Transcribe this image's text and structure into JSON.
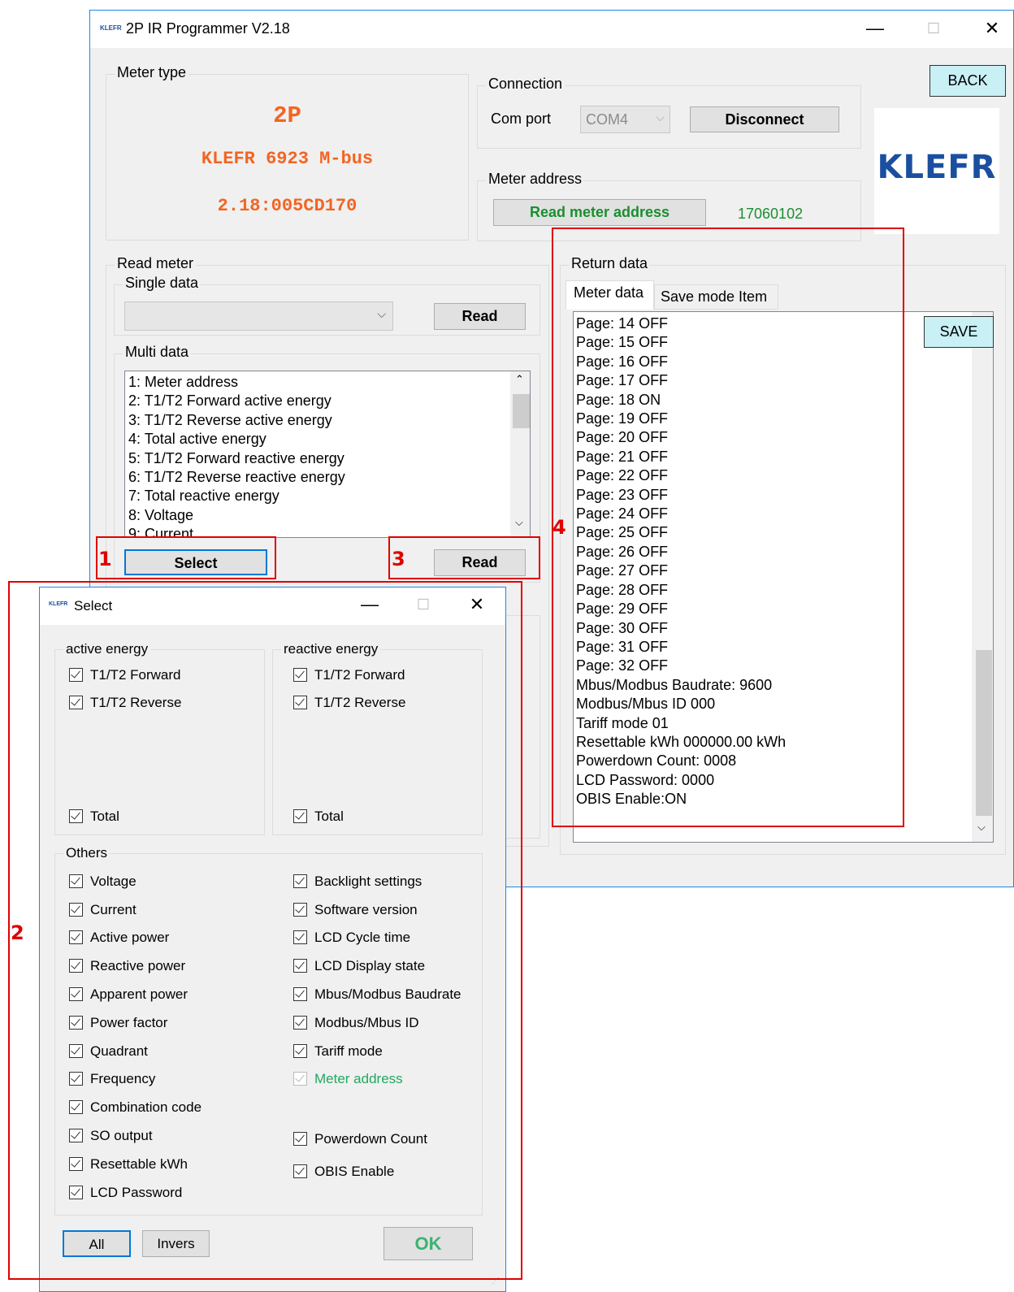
{
  "main_window": {
    "title": "2P IR Programmer V2.18",
    "logo_small": "KLEFR",
    "minimize": "—",
    "maximize": "☐",
    "close": "✕",
    "back_label": "BACK",
    "brand_logo": "KLEFR",
    "meter_type": {
      "label": "Meter type",
      "type": "2P",
      "model": "KLEFR 6923 M-bus",
      "version": "2.18:005CD170"
    },
    "connection": {
      "label": "Connection",
      "com_port_label": "Com port",
      "com_port_value": "COM4",
      "disconnect_label": "Disconnect"
    },
    "meter_address": {
      "label": "Meter address",
      "read_button": "Read meter address",
      "value": "17060102"
    },
    "read_meter": {
      "label": "Read meter",
      "single_data_label": "Single data",
      "single_read_label": "Read",
      "multi_data_label": "Multi data",
      "multi_items": [
        "1: Meter address",
        "2: T1/T2 Forward active energy",
        "3: T1/T2 Reverse active energy",
        "4: Total active energy",
        "5: T1/T2 Forward reactive energy",
        "6: T1/T2 Reverse reactive energy",
        "7: Total reactive energy",
        "8: Voltage",
        "9: Current"
      ],
      "select_label": "Select",
      "multi_read_label": "Read"
    },
    "return_data": {
      "label": "Return data",
      "tabs": [
        "Meter data",
        "Save mode Item"
      ],
      "save_label": "SAVE",
      "lines": [
        "Page: 14  OFF",
        "Page: 15  OFF",
        "Page: 16  OFF",
        "Page: 17  OFF",
        "Page: 18  ON",
        "Page: 19  OFF",
        "Page: 20  OFF",
        "Page: 21  OFF",
        "Page: 22  OFF",
        "Page: 23  OFF",
        "Page: 24  OFF",
        "Page: 25  OFF",
        "Page: 26  OFF",
        "Page: 27  OFF",
        "Page: 28  OFF",
        "Page: 29  OFF",
        "Page: 30  OFF",
        "Page: 31  OFF",
        "Page: 32  OFF",
        "Mbus/Modbus Baudrate:  9600",
        "Modbus/Mbus ID  000",
        "Tariff mode  01",
        "Resettable kWh  000000.00 kWh",
        "Powerdown Count: 0008",
        "LCD Password: 0000",
        "OBIS Enable:ON"
      ]
    }
  },
  "select_dialog": {
    "title": "Select",
    "logo_small": "KLEFR",
    "minimize": "—",
    "maximize": "☐",
    "close": "✕",
    "active_energy": {
      "label": "active energy",
      "forward": "T1/T2 Forward",
      "reverse": "T1/T2 Reverse",
      "total": "Total"
    },
    "reactive_energy": {
      "label": "reactive energy",
      "forward": "T1/T2 Forward",
      "reverse": "T1/T2 Reverse",
      "total": "Total"
    },
    "others": {
      "label": "Others",
      "left": [
        "Voltage",
        "Current",
        "Active power",
        "Reactive power",
        "Apparent power",
        "Power factor",
        "Quadrant",
        "Frequency",
        "Combination code",
        "SO output",
        "Resettable kWh",
        "LCD Password"
      ],
      "right": [
        "Backlight settings",
        "Software version",
        "LCD Cycle time",
        "LCD Display state",
        "Mbus/Modbus Baudrate",
        "Modbus/Mbus ID",
        "Tariff mode",
        "Meter address",
        "Powerdown Count",
        "OBIS Enable"
      ]
    },
    "all_label": "All",
    "invers_label": "Invers",
    "ok_label": "OK"
  },
  "annotations": [
    "1",
    "2",
    "3",
    "4"
  ],
  "colors": {
    "orange": "#f26522",
    "green": "#1a8f2e",
    "highlight_cyan": "#c8f0f5",
    "annotation_red": "#e00000",
    "brand_blue": "#1a4fa0"
  }
}
